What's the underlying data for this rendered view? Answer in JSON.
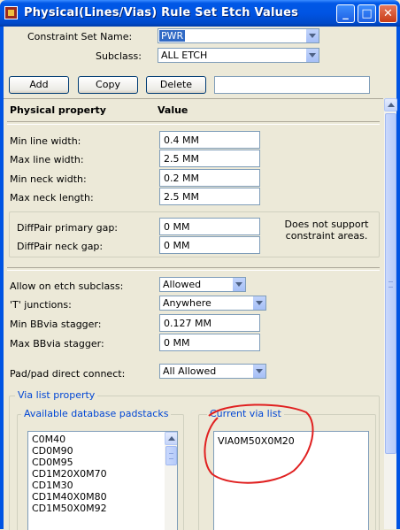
{
  "window": {
    "title": "Physical(Lines/Vias) Rule Set Etch Values",
    "colors": {
      "titlebar": "#0054E3",
      "close_button": "#E7785B",
      "annotation_circle": "#E02020"
    }
  },
  "header": {
    "constraint_set_label": "Constraint Set Name:",
    "constraint_set_value": "PWR",
    "subclass_label": "Subclass:",
    "subclass_value": "ALL ETCH"
  },
  "toolbar": {
    "add_label": "Add",
    "copy_label": "Copy",
    "delete_label": "Delete",
    "name_input_value": ""
  },
  "table": {
    "col_property": "Physical property",
    "col_value": "Value"
  },
  "rows": {
    "min_line_width": {
      "label": "Min line width:",
      "value": "0.4 MM"
    },
    "max_line_width": {
      "label": "Max line width:",
      "value": "2.5 MM"
    },
    "min_neck_width": {
      "label": "Min neck width:",
      "value": "0.2 MM"
    },
    "max_neck_length": {
      "label": "Max neck length:",
      "value": "2.5 MM"
    },
    "diffpair_primary_gap": {
      "label": "DiffPair primary gap:",
      "value": "0 MM"
    },
    "diffpair_neck_gap": {
      "label": "DiffPair neck gap:",
      "value": "0 MM"
    },
    "diffpair_note": "Does not support\nconstraint areas.",
    "allow_on_etch_subclass": {
      "label": "Allow on etch subclass:",
      "value": "Allowed"
    },
    "t_junctions": {
      "label": "'T' junctions:",
      "value": "Anywhere"
    },
    "min_bbvia_stagger": {
      "label": "Min BBvia stagger:",
      "value": "0.127 MM"
    },
    "max_bbvia_stagger": {
      "label": "Max BBvia stagger:",
      "value": "0 MM"
    },
    "pad_pad_direct_connect": {
      "label": "Pad/pad direct connect:",
      "value": "All Allowed"
    }
  },
  "via_list": {
    "group_label": "Via list property",
    "available_label": "Available database padstacks",
    "current_label": "Current via list",
    "available_items": [
      "C0M40",
      "CD0M90",
      "CD0M95",
      "CD1M20X0M70",
      "CD1M30",
      "CD1M40X0M80",
      "CD1M50X0M92"
    ],
    "current_items": [
      "VIA0M50X0M20"
    ]
  },
  "icons": {
    "app": "app-icon",
    "minimize": "minimize-icon",
    "maximize": "maximize-icon",
    "close": "close-icon",
    "dropdown": "chevron-down-icon",
    "scroll_up": "scroll-up-arrow-icon"
  }
}
